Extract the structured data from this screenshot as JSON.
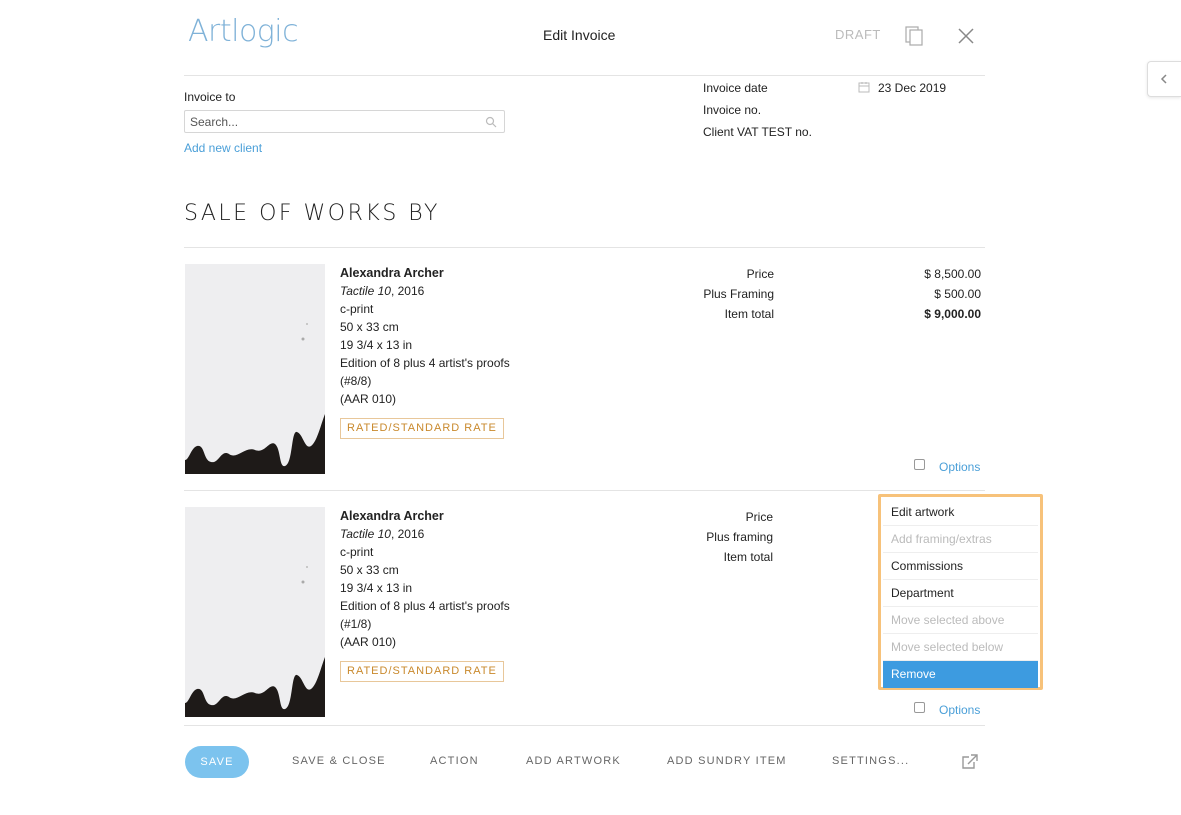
{
  "header": {
    "logo": "Artlogic",
    "title": "Edit Invoice",
    "status": "DRAFT"
  },
  "invoice": {
    "invoice_to_label": "Invoice to",
    "search_placeholder": "Search...",
    "add_client_label": "Add new client",
    "date_label": "Invoice date",
    "date_value": "23 Dec 2019",
    "number_label": "Invoice no.",
    "vat_label": "Client VAT TEST no."
  },
  "section_title": "SALE OF WORKS BY",
  "items": [
    {
      "artist": "Alexandra Archer",
      "title": "Tactile 10",
      "year": ", 2016",
      "medium": "c-print",
      "dims_cm": "50 x 33 cm",
      "dims_in": "19 3/4 x 13 in",
      "edition": "Edition of 8 plus 4 artist's proofs",
      "edition_no": "(#8/8)",
      "stock": "(AAR 010)",
      "rate": "RATED/STANDARD RATE",
      "price_label": "Price",
      "framing_label": "Plus Framing",
      "total_label": "Item total",
      "price": "$ 8,500.00",
      "framing": "$ 500.00",
      "total": "$ 9,000.00",
      "options_label": "Options"
    },
    {
      "artist": "Alexandra Archer",
      "title": "Tactile 10",
      "year": ", 2016",
      "medium": "c-print",
      "dims_cm": "50 x 33 cm",
      "dims_in": "19 3/4 x 13 in",
      "edition": "Edition of 8 plus 4 artist's proofs",
      "edition_no": "(#1/8)",
      "stock": "(AAR 010)",
      "rate": "RATED/STANDARD RATE",
      "price_label": "Price",
      "framing_label": "Plus framing",
      "total_label": "Item total",
      "options_label": "Options"
    }
  ],
  "dropdown": {
    "items": [
      {
        "label": "Edit artwork",
        "state": "enabled"
      },
      {
        "label": "Add framing/extras",
        "state": "disabled"
      },
      {
        "label": "Commissions",
        "state": "enabled"
      },
      {
        "label": "Department",
        "state": "enabled"
      },
      {
        "label": "Move selected above",
        "state": "disabled"
      },
      {
        "label": "Move selected below",
        "state": "disabled"
      },
      {
        "label": "Remove",
        "state": "active"
      }
    ]
  },
  "footer": {
    "save": "SAVE",
    "save_close": "SAVE & CLOSE",
    "action": "ACTION",
    "add_artwork": "ADD ARTWORK",
    "add_sundry": "ADD SUNDRY ITEM",
    "settings": "SETTINGS..."
  },
  "colors": {
    "accent": "#4a9fd8",
    "save_button": "#7cc3ee",
    "highlight_border": "#f7c27a",
    "active_item": "#3d9be0",
    "rate_badge": "#c9892c"
  }
}
